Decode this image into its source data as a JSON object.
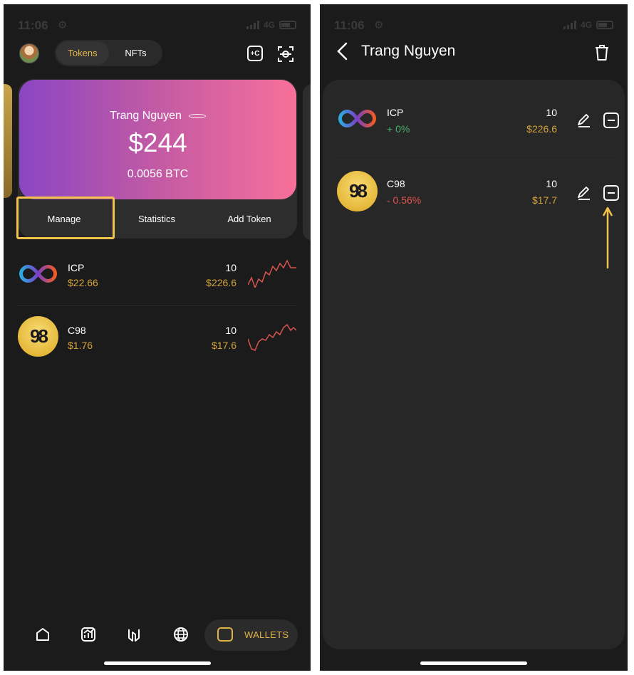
{
  "status": {
    "time": "11:06",
    "network": "4G"
  },
  "left": {
    "tabs": {
      "tokens": "Tokens",
      "nfts": "NFTs"
    },
    "card": {
      "name": "Trang Nguyen",
      "amount": "$244",
      "btc": "0.0056 BTC"
    },
    "actions": {
      "manage": "Manage",
      "statistics": "Statistics",
      "add_token": "Add Token"
    },
    "tokens": [
      {
        "symbol": "ICP",
        "price": "$22.66",
        "qty": "10",
        "value": "$226.6"
      },
      {
        "symbol": "C98",
        "price": "$1.76",
        "qty": "10",
        "value": "$17.6"
      }
    ],
    "nav": {
      "wallets": "WALLETS"
    }
  },
  "right": {
    "title": "Trang Nguyen",
    "tokens": [
      {
        "symbol": "ICP",
        "change": "+ 0%",
        "qty": "10",
        "value": "$226.6"
      },
      {
        "symbol": "C98",
        "change": "- 0.56%",
        "qty": "10",
        "value": "$17.7"
      }
    ]
  },
  "colors": {
    "accent": "#e4b84a",
    "positive": "#4caf6e",
    "negative": "#e0534f",
    "highlight": "#f2c24a"
  }
}
